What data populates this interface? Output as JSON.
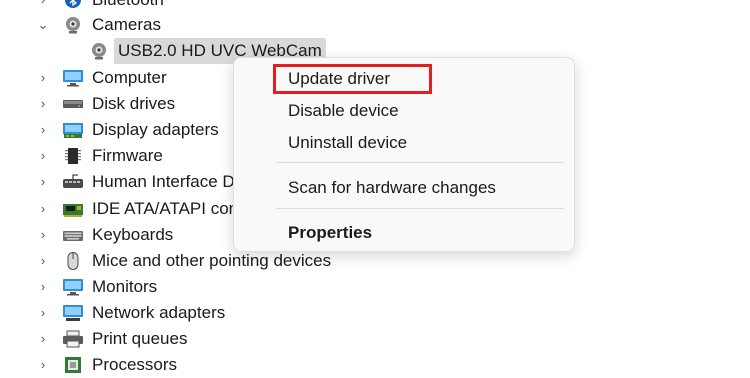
{
  "tree": {
    "items": [
      {
        "label": "Bluetooth",
        "chevron": "›",
        "icon": "bluetooth-icon"
      },
      {
        "label": "Cameras",
        "chevron": "⌄",
        "icon": "camera-icon"
      },
      {
        "label": "USB2.0 HD UVC WebCam",
        "icon": "webcam-icon"
      },
      {
        "label": "Computer",
        "chevron": "›",
        "icon": "computer-icon"
      },
      {
        "label": "Disk drives",
        "chevron": "›",
        "icon": "disk-drive-icon"
      },
      {
        "label": "Display adapters",
        "chevron": "›",
        "icon": "display-adapter-icon"
      },
      {
        "label": "Firmware",
        "chevron": "›",
        "icon": "firmware-icon"
      },
      {
        "label": "Human Interface D",
        "chevron": "›",
        "icon": "hid-icon"
      },
      {
        "label": "IDE ATA/ATAPI contr",
        "chevron": "›",
        "icon": "ide-controller-icon"
      },
      {
        "label": "Keyboards",
        "chevron": "›",
        "icon": "keyboard-icon"
      },
      {
        "label": "Mice and other pointing devices",
        "chevron": "›",
        "icon": "mouse-icon"
      },
      {
        "label": "Monitors",
        "chevron": "›",
        "icon": "monitor-icon"
      },
      {
        "label": "Network adapters",
        "chevron": "›",
        "icon": "network-adapter-icon"
      },
      {
        "label": "Print queues",
        "chevron": "›",
        "icon": "printer-icon"
      },
      {
        "label": "Processors",
        "chevron": "›",
        "icon": "processor-icon"
      }
    ]
  },
  "context_menu": {
    "update_driver": "Update driver",
    "disable_device": "Disable device",
    "uninstall_device": "Uninstall device",
    "scan_hardware": "Scan for hardware changes",
    "properties": "Properties",
    "highlight_color": "#e0201e"
  }
}
